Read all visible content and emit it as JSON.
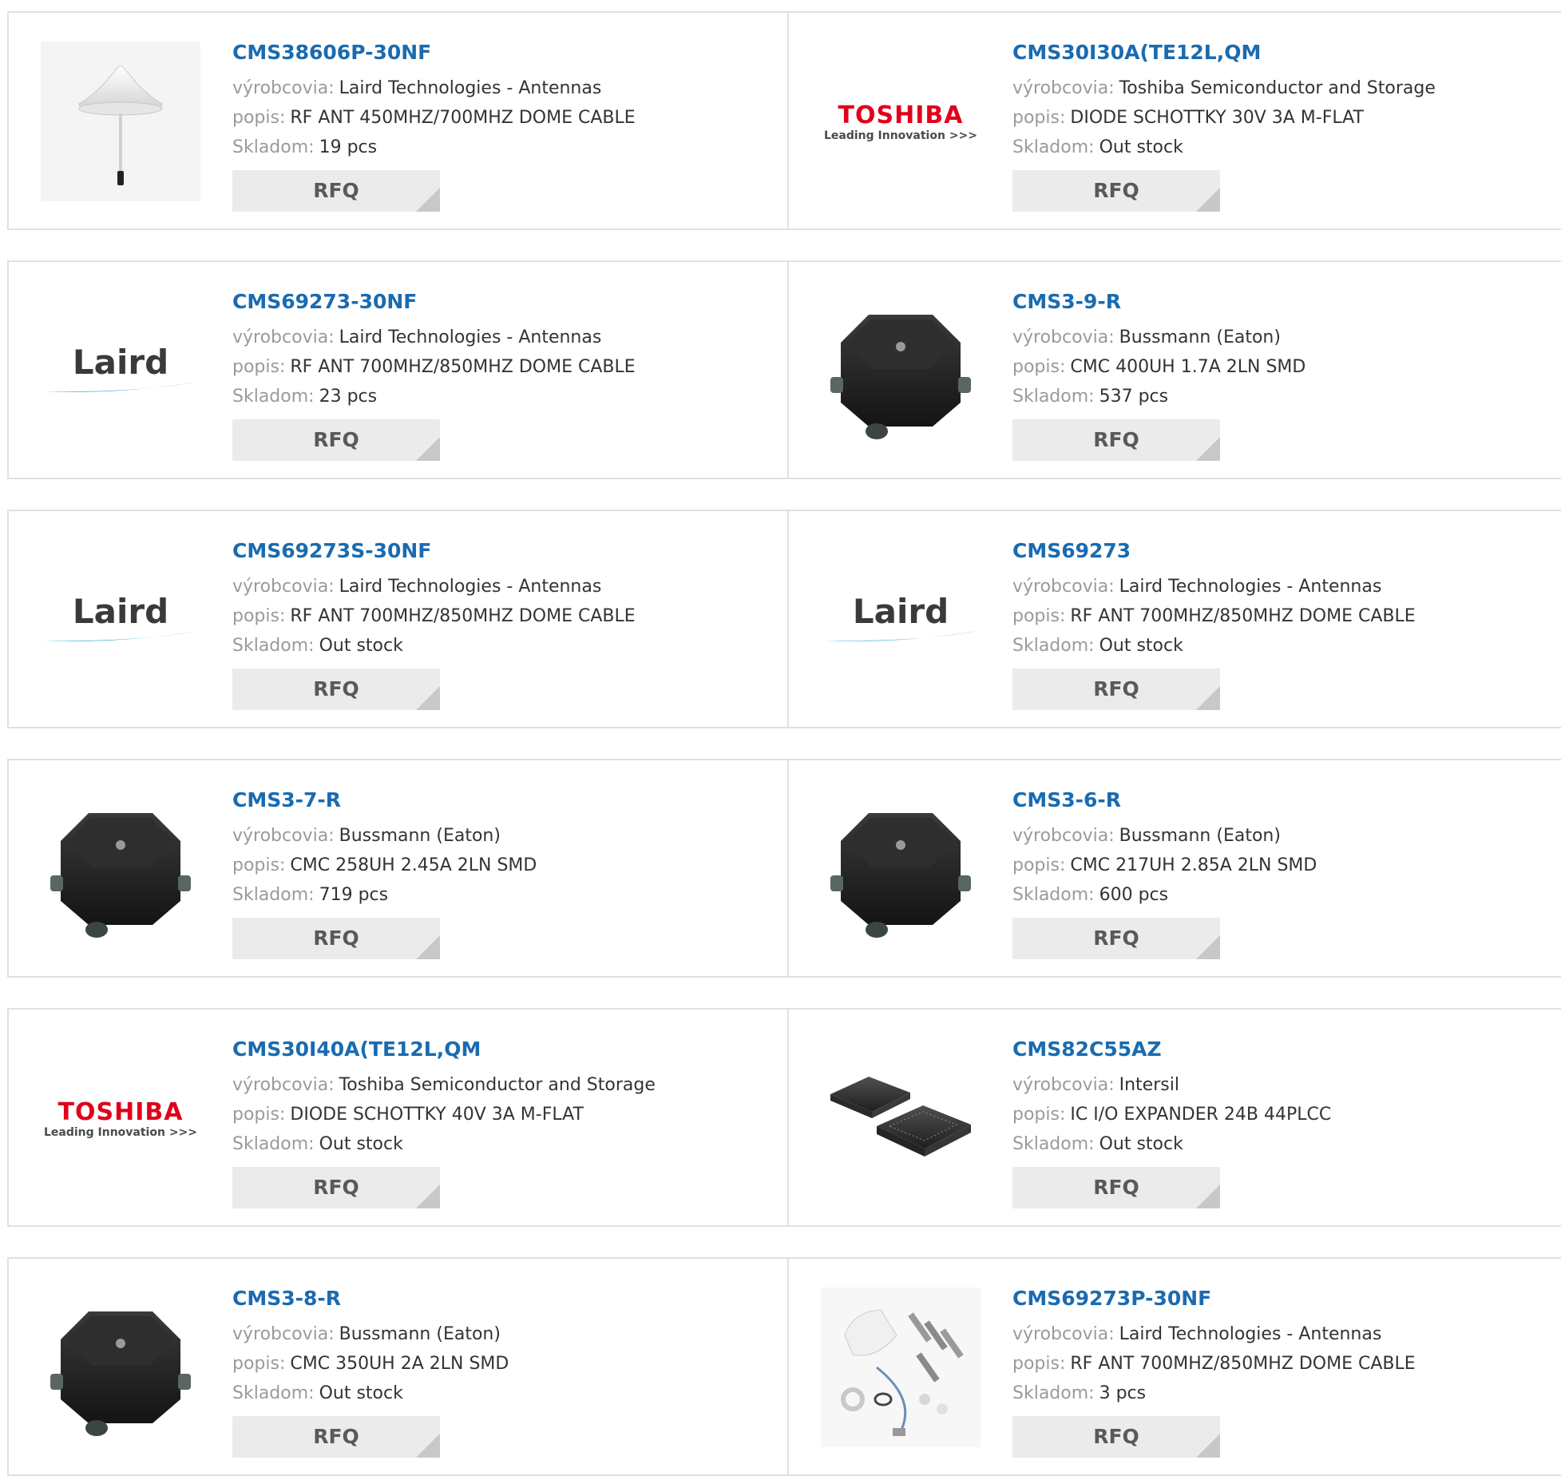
{
  "labels": {
    "manufacturer": "výrobcovia:",
    "description": "popis:",
    "stock": "Skladom:",
    "rfq": "RFQ"
  },
  "logos": {
    "toshiba_name": "TOSHIBA",
    "toshiba_tagline": "Leading Innovation >>>",
    "laird_name": "Laird"
  },
  "products": [
    {
      "part": "CMS38606P-30NF",
      "manufacturer": "Laird Technologies - Antennas",
      "description": "RF ANT 450MHZ/700MHZ DOME CABLE",
      "stock": "19 pcs",
      "image": "dome-antenna-icon"
    },
    {
      "part": "CMS30I30A(TE12L,QM",
      "manufacturer": "Toshiba Semiconductor and Storage",
      "description": "DIODE SCHOTTKY 30V 3A M-FLAT",
      "stock": "Out stock",
      "image": "toshiba-logo"
    },
    {
      "part": "CMS69273-30NF",
      "manufacturer": "Laird Technologies - Antennas",
      "description": "RF ANT 700MHZ/850MHZ DOME CABLE",
      "stock": "23 pcs",
      "image": "laird-logo"
    },
    {
      "part": "CMS3-9-R",
      "manufacturer": "Bussmann (Eaton)",
      "description": "CMC 400UH 1.7A 2LN SMD",
      "stock": "537 pcs",
      "image": "octagon-inductor-icon"
    },
    {
      "part": "CMS69273S-30NF",
      "manufacturer": "Laird Technologies - Antennas",
      "description": "RF ANT 700MHZ/850MHZ DOME CABLE",
      "stock": "Out stock",
      "image": "laird-logo"
    },
    {
      "part": "CMS69273",
      "manufacturer": "Laird Technologies - Antennas",
      "description": "RF ANT 700MHZ/850MHZ DOME CABLE",
      "stock": "Out stock",
      "image": "laird-logo"
    },
    {
      "part": "CMS3-7-R",
      "manufacturer": "Bussmann (Eaton)",
      "description": "CMC 258UH 2.45A 2LN SMD",
      "stock": "719 pcs",
      "image": "octagon-inductor-icon"
    },
    {
      "part": "CMS3-6-R",
      "manufacturer": "Bussmann (Eaton)",
      "description": "CMC 217UH 2.85A 2LN SMD",
      "stock": "600 pcs",
      "image": "octagon-inductor-icon"
    },
    {
      "part": "CMS30I40A(TE12L,QM",
      "manufacturer": "Toshiba Semiconductor and Storage",
      "description": "DIODE SCHOTTKY 40V 3A M-FLAT",
      "stock": "Out stock",
      "image": "toshiba-logo"
    },
    {
      "part": "CMS82C55AZ",
      "manufacturer": "Intersil",
      "description": "IC I/O EXPANDER 24B 44PLCC",
      "stock": "Out stock",
      "image": "plcc-chip-icon"
    },
    {
      "part": "CMS3-8-R",
      "manufacturer": "Bussmann (Eaton)",
      "description": "CMC 350UH 2A 2LN SMD",
      "stock": "Out stock",
      "image": "octagon-inductor-icon"
    },
    {
      "part": "CMS69273P-30NF",
      "manufacturer": "Laird Technologies - Antennas",
      "description": "RF ANT 700MHZ/850MHZ DOME CABLE",
      "stock": "3 pcs",
      "image": "antenna-kit-icon"
    }
  ]
}
